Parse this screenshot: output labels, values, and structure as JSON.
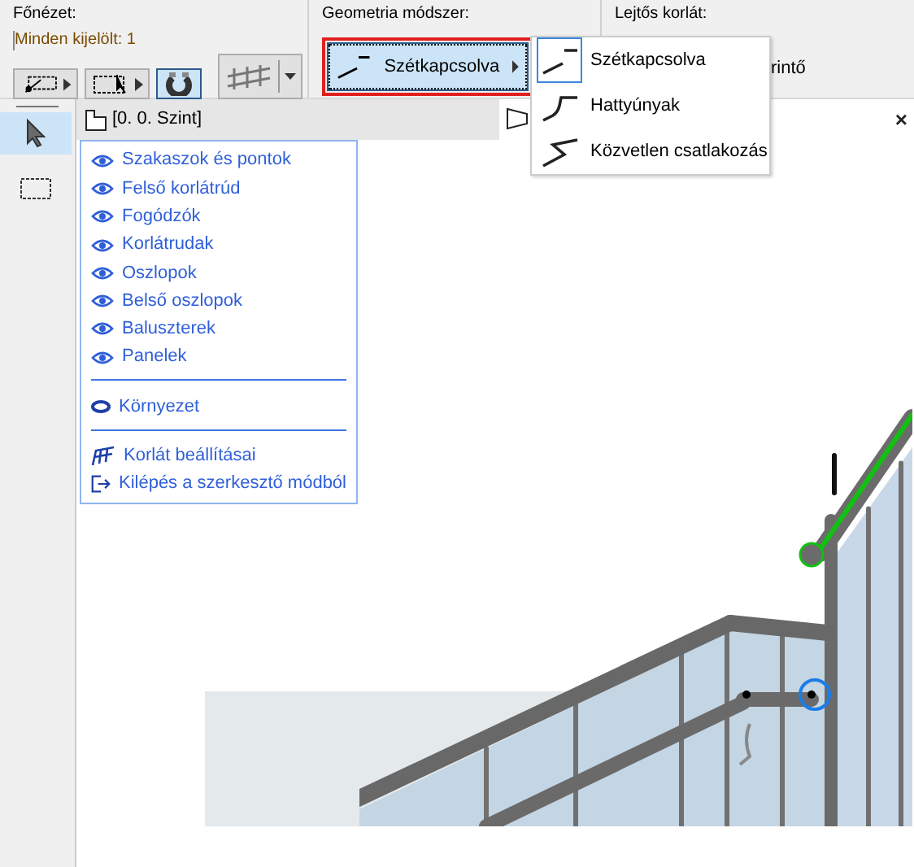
{
  "view_section": {
    "label": "Főnézet:",
    "selection_info": "Minden kijelölt: 1",
    "buttons": [
      {
        "kind": "select-points",
        "selected": false
      },
      {
        "kind": "marquee-arrow",
        "selected": false
      },
      {
        "kind": "magnet",
        "selected": true
      },
      {
        "kind": "railing",
        "selected": false
      }
    ]
  },
  "geometry_section": {
    "label": "Geometria módszer:",
    "button": {
      "label": "Szétkapcsolva",
      "outlined": true
    }
  },
  "slope_section": {
    "label": "Lejtős korlát:",
    "value": "rintő"
  },
  "geometry_menu": {
    "items": [
      {
        "kind": "separate",
        "label": "Szétkapcsolva",
        "selected": true
      },
      {
        "kind": "gooseneck",
        "label": "Hattyúnyak",
        "selected": false
      },
      {
        "kind": "direct",
        "label": "Közvetlen csatlakozás",
        "selected": false
      }
    ]
  },
  "toolbox": {
    "tools": [
      {
        "kind": "arrow",
        "selected": true
      },
      {
        "kind": "marquee",
        "selected": false
      }
    ]
  },
  "view_tab": {
    "label": "[0. 0. Szint]"
  },
  "close": "×",
  "visibility_panel": {
    "groups": [
      {
        "items": [
          {
            "kind": "eye",
            "label": "Szakaszok és pontok"
          },
          {
            "kind": "eye",
            "label": "Felső korlátrúd"
          },
          {
            "kind": "eye",
            "label": "Fogódzók"
          },
          {
            "kind": "eye",
            "label": "Korlátrudak"
          },
          {
            "kind": "eye",
            "label": "Oszlopok"
          },
          {
            "kind": "eye",
            "label": "Belső oszlopok"
          },
          {
            "kind": "eye",
            "label": "Baluszterek"
          },
          {
            "kind": "eye",
            "label": "Panelek"
          }
        ]
      },
      {
        "items": [
          {
            "kind": "context",
            "label": "Környezet"
          }
        ]
      },
      {
        "items": [
          {
            "kind": "settings",
            "label": "Korlát beállításai"
          },
          {
            "kind": "exit",
            "label": "Kilépés a szerkesztő módból"
          }
        ]
      }
    ]
  }
}
